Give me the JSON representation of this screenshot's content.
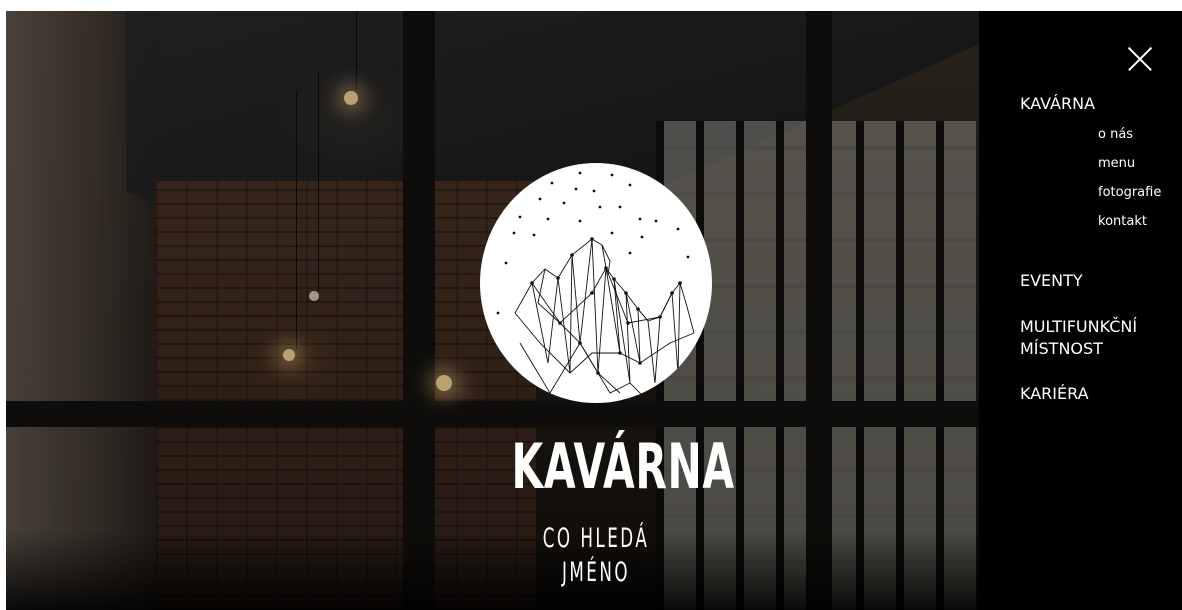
{
  "hero": {
    "logo_title": "KAVÁRNA",
    "logo_subtitle": "CO HLEDÁ JMÉNO"
  },
  "side_nav": {
    "close_icon": "close-icon",
    "items": [
      {
        "label": "KAVÁRNA",
        "subitems": [
          "o nás",
          "menu",
          "fotografie",
          "kontakt"
        ]
      },
      {
        "label": "EVENTY"
      },
      {
        "label": "MULTIFUNKČNÍ MÍSTNOST"
      },
      {
        "label": "KARIÉRA"
      }
    ]
  },
  "colors": {
    "panel_background": "#000000",
    "text": "#ffffff"
  }
}
